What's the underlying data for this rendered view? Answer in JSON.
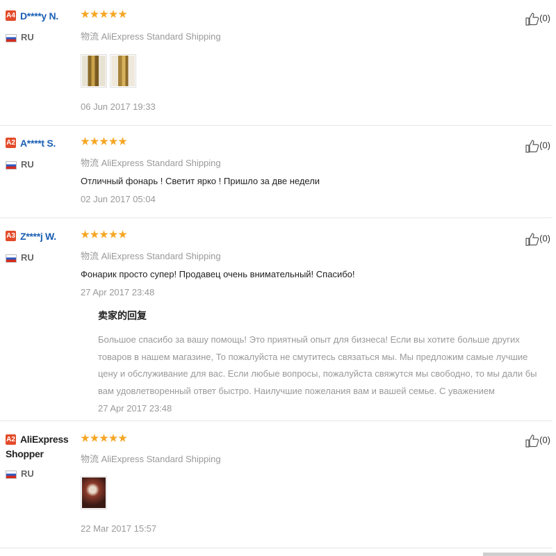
{
  "reviews": [
    {
      "level": "A4",
      "name": "D****y N.",
      "country": "RU",
      "shipping": "物流 AliExpress Standard Shipping",
      "text": "",
      "date": "06 Jun 2017 19:33",
      "likes": "(0)",
      "rating": 5,
      "photos": [
        "product-photo-1",
        "product-photo-2"
      ]
    },
    {
      "level": "A2",
      "name": "A****t S.",
      "country": "RU",
      "shipping": "物流 AliExpress Standard Shipping",
      "text": "Отличный фонарь ! Светит ярко ! Пришло за две недели",
      "date": "02 Jun 2017 05:04",
      "likes": "(0)",
      "rating": 5,
      "photos": []
    },
    {
      "level": "A3",
      "name": "Z****j W.",
      "country": "RU",
      "shipping": "物流 AliExpress Standard Shipping",
      "text": "Фонарик просто супер! Продавец очень внимательный! Спасибо!",
      "date": "27 Apr 2017 23:48",
      "likes": "(0)",
      "rating": 5,
      "photos": [],
      "seller_reply": {
        "title": "卖家的回复",
        "text": "Большое спасибо за вашу помощь! Это приятный опыт для бизнеса! Если вы хотите больше других товаров в нашем магазине, То пожалуйста не смутитесь связаться мы. Мы предложим самые лучшие цену и обслуживание для вас. Если любые вопросы, пожалуйста свяжутся мы свободно, то мы дали бы вам удовлетворенный ответ быстро. Наилучшие пожелания вам и вашей семье. С уважением",
        "date": "27 Apr 2017 23:48"
      }
    },
    {
      "level": "A2",
      "name": "AliExpress Shopper",
      "country": "RU",
      "shipping": "物流 AliExpress Standard Shipping",
      "text": "",
      "date": "22 Mar 2017 15:57",
      "likes": "(0)",
      "rating": 5,
      "photos": [
        "product-photo-1"
      ]
    }
  ],
  "colors": {
    "star": "#f5a623",
    "level_badge": "#e34b2a",
    "username": "#1a5fb4"
  }
}
